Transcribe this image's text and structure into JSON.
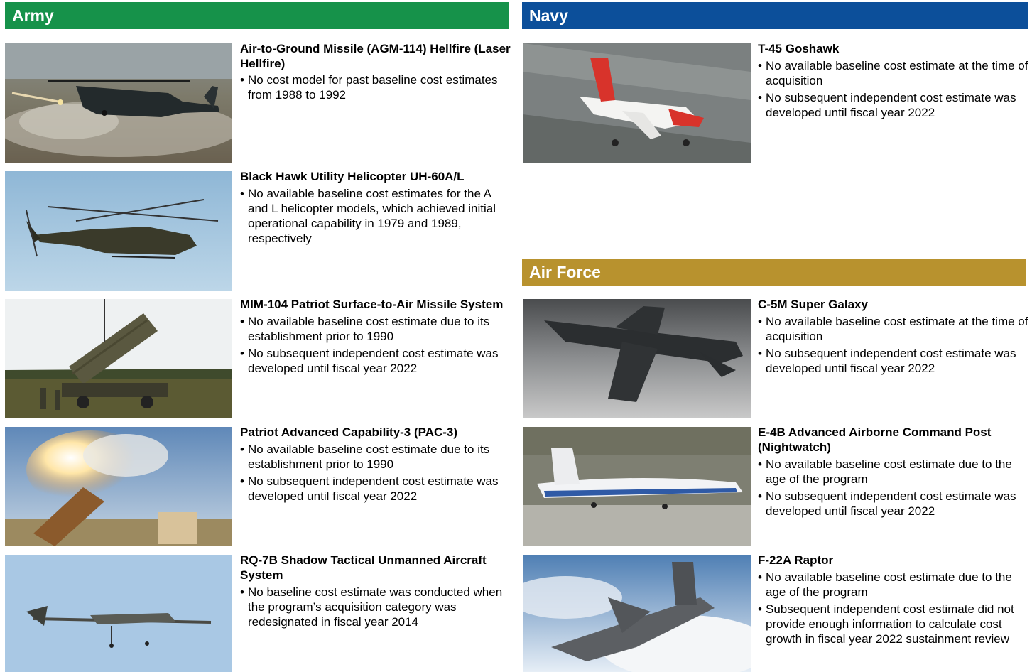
{
  "sections": {
    "army": "Army",
    "navy": "Navy",
    "air_force": "Air Force"
  },
  "army": [
    {
      "title": "Air-to-Ground Missile (AGM-114) Hellfire (Laser Hellfire)",
      "bullets": [
        "No cost model for past baseline cost estimates from 1988 to 1992"
      ]
    },
    {
      "title": "Black Hawk Utility Helicopter UH-60A/L",
      "bullets": [
        "No available baseline cost estimates for the A and L helicopter models, which achieved initial operational capability in 1979 and 1989, respectively"
      ]
    },
    {
      "title": "MIM-104 Patriot Surface-to-Air Missile System",
      "bullets": [
        "No available baseline cost estimate due to its establishment prior to 1990",
        "No subsequent independent cost estimate was developed until fiscal year 2022"
      ]
    },
    {
      "title": "Patriot Advanced Capability-3 (PAC-3)",
      "bullets": [
        "No available baseline cost estimate due to its establishment prior to 1990",
        "No subsequent independent cost estimate was developed until fiscal year 2022"
      ]
    },
    {
      "title": "RQ-7B Shadow Tactical Unmanned Aircraft System",
      "bullets": [
        "No baseline cost estimate was conducted when the program’s acquisition category was redesignated in fiscal year 2014"
      ]
    }
  ],
  "navy": [
    {
      "title": "T-45 Goshawk",
      "bullets": [
        "No available baseline cost estimate at the time of acquisition",
        "No subsequent independent cost estimate was developed until fiscal year 2022"
      ]
    }
  ],
  "air_force": [
    {
      "title": "C-5M Super Galaxy",
      "bullets": [
        "No available baseline cost estimate at the time of acquisition",
        "No subsequent independent cost estimate was developed until fiscal year 2022"
      ]
    },
    {
      "title": "E-4B Advanced Airborne Command Post (Nightwatch)",
      "bullets": [
        "No available baseline cost estimate due to the age of the program",
        "No subsequent independent cost estimate was developed until fiscal year 2022"
      ]
    },
    {
      "title": "F-22A Raptor",
      "bullets": [
        "No available baseline cost estimate due to the age of the program",
        "Subsequent independent cost estimate did not provide enough information to calculate cost growth in fiscal year 2022 sustainment review"
      ]
    }
  ],
  "colors": {
    "army_banner": "#16924a",
    "navy_banner": "#0c4f9a",
    "air_force_banner": "#b8922e"
  }
}
